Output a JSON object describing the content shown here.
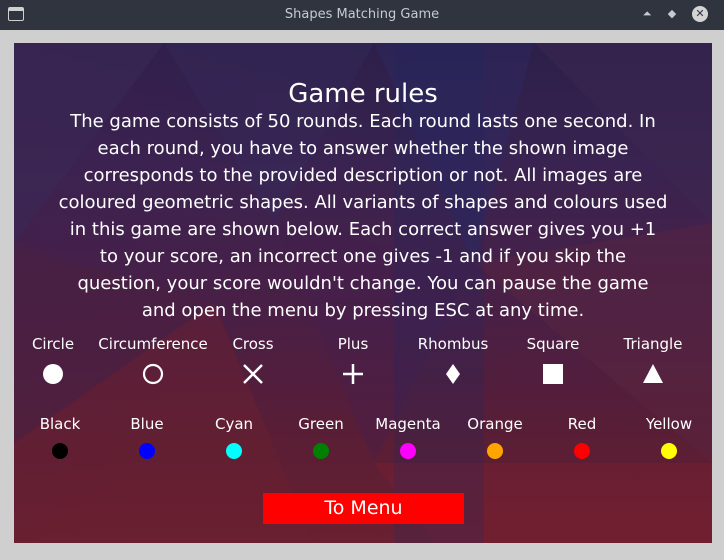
{
  "window": {
    "title": "Shapes Matching Game",
    "min_symbol": "⏶",
    "max_symbol": "◆",
    "close_symbol": "✕"
  },
  "rules": {
    "heading": "Game rules",
    "text": "The game consists of 50 rounds. Each round lasts one second. In each round, you have to answer whether the shown image corresponds to the provided description or not. All images are coloured geometric shapes. All variants of shapes and colours used in this game are shown below. Each correct answer gives you +1 to your score, an incorrect one gives -1 and if you skip the question, your score wouldn't change. You can pause the game and open the menu by pressing ESC at any time."
  },
  "shapes": [
    {
      "label": "Circle",
      "icon": "circle-icon"
    },
    {
      "label": "Circumference",
      "icon": "circumference-icon"
    },
    {
      "label": "Cross",
      "icon": "cross-icon"
    },
    {
      "label": "Plus",
      "icon": "plus-icon"
    },
    {
      "label": "Rhombus",
      "icon": "rhombus-icon"
    },
    {
      "label": "Square",
      "icon": "square-icon"
    },
    {
      "label": "Triangle",
      "icon": "triangle-icon"
    }
  ],
  "colors": [
    {
      "label": "Black",
      "hex": "#000000"
    },
    {
      "label": "Blue",
      "hex": "#0000ff"
    },
    {
      "label": "Cyan",
      "hex": "#00ffff"
    },
    {
      "label": "Green",
      "hex": "#008000"
    },
    {
      "label": "Magenta",
      "hex": "#ff00ff"
    },
    {
      "label": "Orange",
      "hex": "#ffa500"
    },
    {
      "label": "Red",
      "hex": "#ff0000"
    },
    {
      "label": "Yellow",
      "hex": "#ffff00"
    }
  ],
  "menu_button": {
    "label": "To Menu",
    "color": "#ff0000"
  }
}
